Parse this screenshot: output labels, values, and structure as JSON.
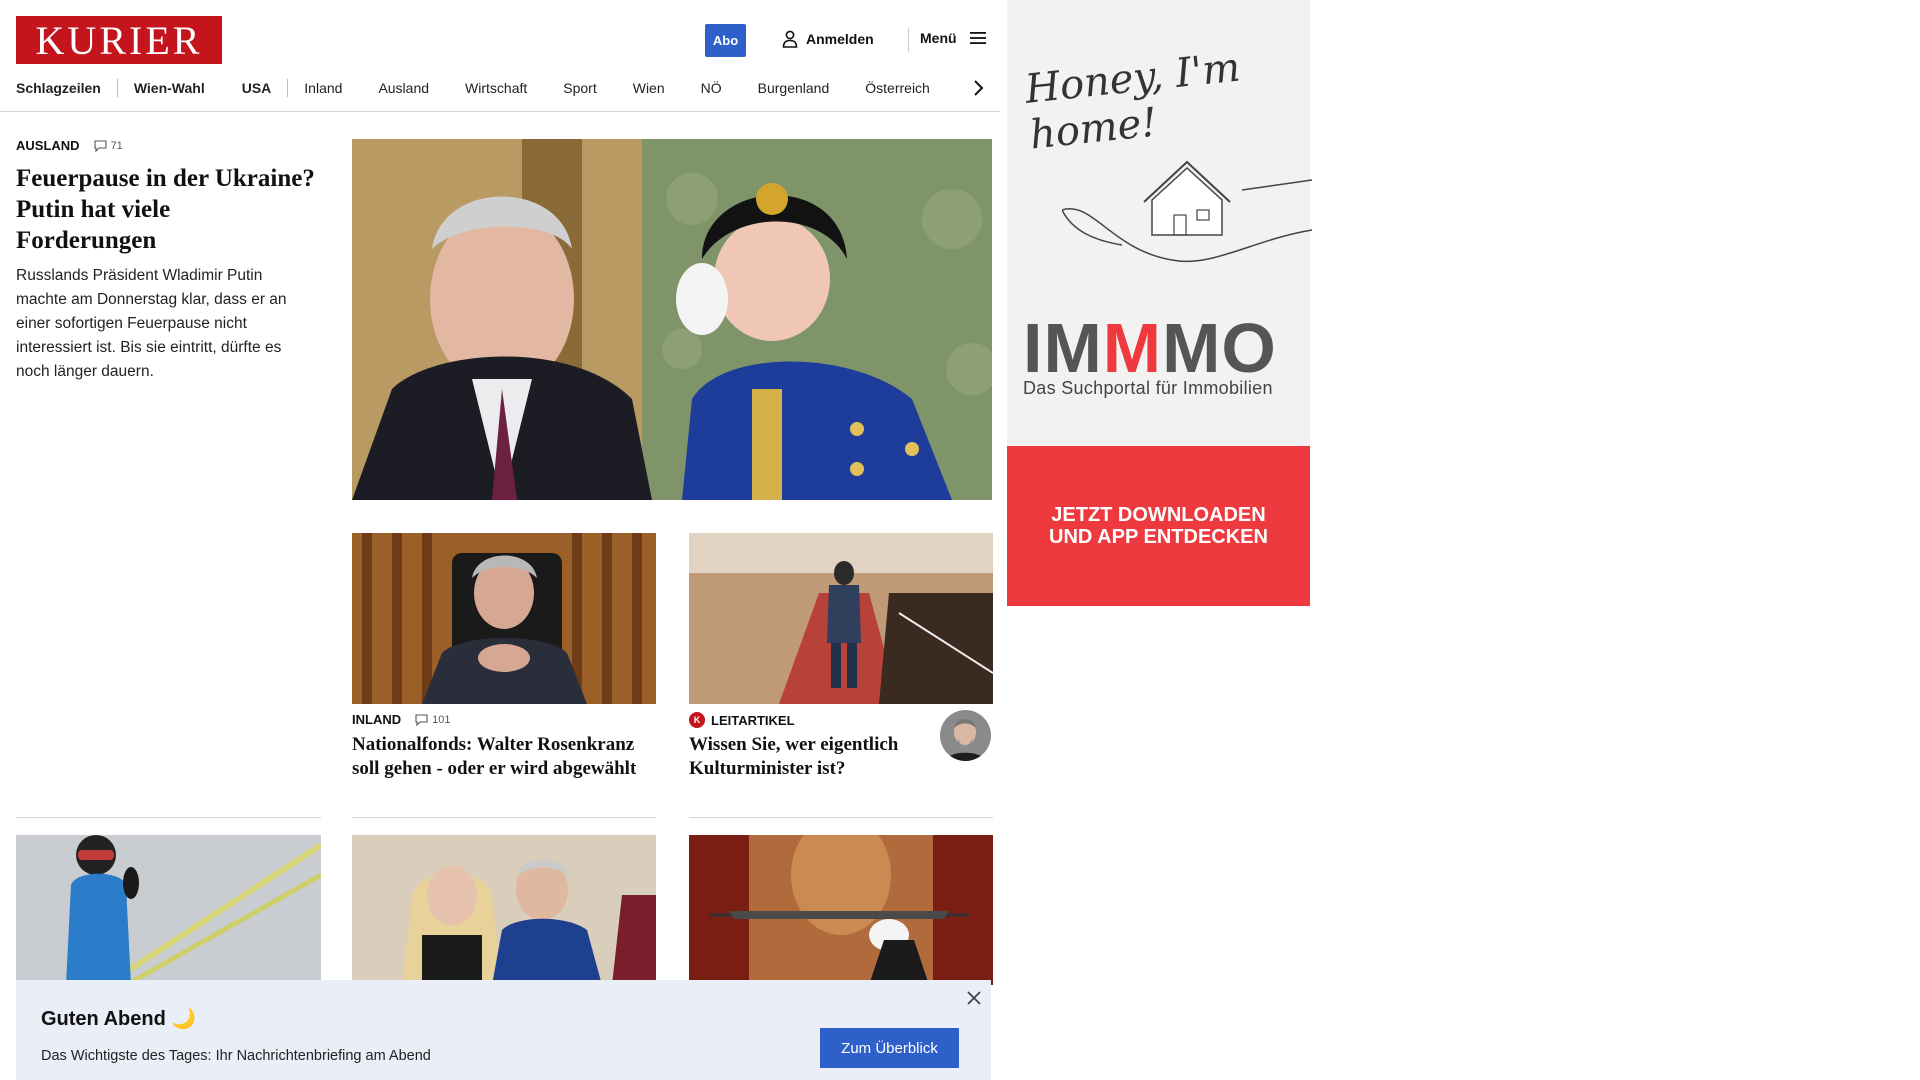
{
  "header": {
    "logo_text": "KURIER",
    "abo_label": "Abo",
    "login_label": "Anmelden",
    "menu_label": "Menü"
  },
  "nav": {
    "items": [
      "Schlagzeilen",
      "Wien-Wahl",
      "USA",
      "Inland",
      "Ausland",
      "Wirtschaft",
      "Sport",
      "Wien",
      "NÖ",
      "Burgenland",
      "Österreich"
    ]
  },
  "lead": {
    "section": "AUSLAND",
    "comments": "71",
    "title": "Feuerpause in der Ukraine? Putin hat viele Forderungen",
    "description": "Russlands Präsident Wladimir Putin machte am Donnerstag klar, dass er an einer sofortigen Feuerpause nicht interessiert ist. Bis sie eintritt, dürfte es noch länger dauern."
  },
  "cards": [
    {
      "section": "INLAND",
      "comments": "101",
      "title": "Nationalfonds: Walter Rosenkranz soll gehen - oder er wird abgewählt"
    },
    {
      "section": "LEITARTIKEL",
      "badge": "K",
      "title": "Wissen Sie, wer eigentlich Kulturminister ist?"
    }
  ],
  "ad": {
    "tagline": "Honey, I'm home!",
    "brand_parts": [
      "IM",
      "M",
      "MO"
    ],
    "subtitle": "Das Suchportal für Immobilien",
    "cta_line1": "JETZT DOWNLOADEN",
    "cta_line2": "UND APP ENTDECKEN"
  },
  "banner": {
    "title": "Guten Abend 🌙",
    "text": "Das Wichtigste des Tages: Ihr Nachrichtenbriefing am Abend",
    "button": "Zum Überblick"
  },
  "colors": {
    "brand_red": "#c4141c",
    "accent_blue": "#2f5fc9",
    "ad_red": "#ee3a3f",
    "banner_bg": "#e9eef7"
  },
  "icons": [
    "user-icon",
    "hamburger-icon",
    "chevron-right-icon",
    "comment-icon",
    "close-icon"
  ]
}
